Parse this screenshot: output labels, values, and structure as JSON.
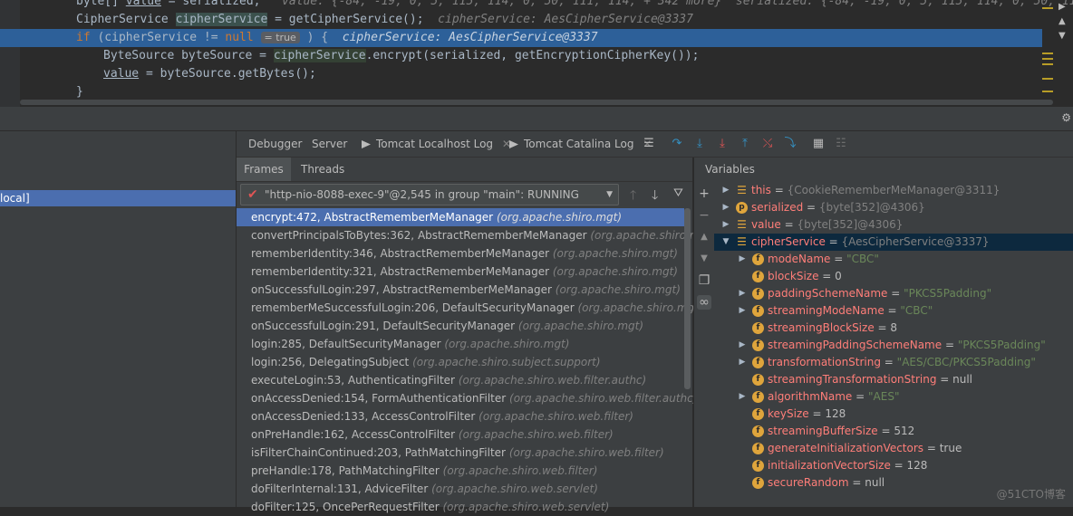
{
  "editor": {
    "lines": [
      {
        "code_a": "byte[] ",
        "code_field": "value",
        "code_b": " = serialized;",
        "hint": "value: {-84, -19, 0, 5, 115, 114, 0, 50, 111, 114, + 342 more}  serialized: {-84, -19, 0, 5, 115, 114, 0, 50, 111, 1"
      },
      {
        "code_a": "CipherService ",
        "code_var": "cipherService",
        "code_b": " = getCipherService();",
        "hint": "cipherService: AesCipherService@3337"
      },
      {
        "code_kw": "if",
        "code_a": " (cipherService != ",
        "code_null": "null",
        "pill": "= true",
        "code_b": " ) {",
        "hint": "cipherService: AesCipherService@3337"
      },
      {
        "code_a": "ByteSource byteSource = ",
        "code_var": "cipherService",
        "code_b": ".encrypt(serialized, getEncryptionCipherKey());"
      },
      {
        "code_field": "value",
        "code_b": " = byteSource.getBytes();"
      },
      {
        "code_b": "}"
      }
    ]
  },
  "left_pane": {
    "selected_label": "local]"
  },
  "debug_tabs": {
    "debugger": "Debugger",
    "server": "Server",
    "tomcat_localhost": "Tomcat Localhost Log",
    "tomcat_catalina": "Tomcat Catalina Log"
  },
  "frames_panel": {
    "tab_frames": "Frames",
    "tab_threads": "Threads",
    "thread": "\"http-nio-8088-exec-9\"@2,545 in group \"main\": RUNNING",
    "frames": [
      {
        "method": "encrypt:472, AbstractRememberMeManager",
        "pkg": "(org.apache.shiro.mgt)"
      },
      {
        "method": "convertPrincipalsToBytes:362, AbstractRememberMeManager",
        "pkg": "(org.apache.shiro.mgt)"
      },
      {
        "method": "rememberIdentity:346, AbstractRememberMeManager",
        "pkg": "(org.apache.shiro.mgt)"
      },
      {
        "method": "rememberIdentity:321, AbstractRememberMeManager",
        "pkg": "(org.apache.shiro.mgt)"
      },
      {
        "method": "onSuccessfulLogin:297, AbstractRememberMeManager",
        "pkg": "(org.apache.shiro.mgt)"
      },
      {
        "method": "rememberMeSuccessfulLogin:206, DefaultSecurityManager",
        "pkg": "(org.apache.shiro.mgt)"
      },
      {
        "method": "onSuccessfulLogin:291, DefaultSecurityManager",
        "pkg": "(org.apache.shiro.mgt)"
      },
      {
        "method": "login:285, DefaultSecurityManager",
        "pkg": "(org.apache.shiro.mgt)"
      },
      {
        "method": "login:256, DelegatingSubject",
        "pkg": "(org.apache.shiro.subject.support)"
      },
      {
        "method": "executeLogin:53, AuthenticatingFilter",
        "pkg": "(org.apache.shiro.web.filter.authc)"
      },
      {
        "method": "onAccessDenied:154, FormAuthenticationFilter",
        "pkg": "(org.apache.shiro.web.filter.authc)"
      },
      {
        "method": "onAccessDenied:133, AccessControlFilter",
        "pkg": "(org.apache.shiro.web.filter)"
      },
      {
        "method": "onPreHandle:162, AccessControlFilter",
        "pkg": "(org.apache.shiro.web.filter)"
      },
      {
        "method": "isFilterChainContinued:203, PathMatchingFilter",
        "pkg": "(org.apache.shiro.web.filter)"
      },
      {
        "method": "preHandle:178, PathMatchingFilter",
        "pkg": "(org.apache.shiro.web.filter)"
      },
      {
        "method": "doFilterInternal:131, AdviceFilter",
        "pkg": "(org.apache.shiro.web.servlet)"
      },
      {
        "method": "doFilter:125, OncePerRequestFilter",
        "pkg": "(org.apache.shiro.web.servlet)"
      }
    ]
  },
  "variables_panel": {
    "title": "Variables",
    "vars": [
      {
        "name": "this",
        "value": "{CookieRememberMeManager@3311}",
        "vtype": "meta",
        "icon": "list",
        "expandable": true,
        "indent": 0
      },
      {
        "name": "serialized",
        "value": "{byte[352]@4306}",
        "vtype": "meta",
        "icon": "p",
        "expandable": true,
        "indent": 0
      },
      {
        "name": "value",
        "value": "{byte[352]@4306}",
        "vtype": "meta",
        "icon": "list",
        "expandable": true,
        "indent": 0
      },
      {
        "name": "cipherService",
        "value": "{AesCipherService@3337}",
        "vtype": "meta",
        "icon": "list",
        "expandable": true,
        "expanded": true,
        "indent": 0,
        "selected": true
      },
      {
        "name": "modeName",
        "value": "\"CBC\"",
        "vtype": "str",
        "icon": "f",
        "expandable": true,
        "indent": 1
      },
      {
        "name": "blockSize",
        "value": "0",
        "vtype": "num",
        "icon": "f",
        "expandable": false,
        "indent": 1
      },
      {
        "name": "paddingSchemeName",
        "value": "\"PKCS5Padding\"",
        "vtype": "str",
        "icon": "f",
        "expandable": true,
        "indent": 1
      },
      {
        "name": "streamingModeName",
        "value": "\"CBC\"",
        "vtype": "str",
        "icon": "f",
        "expandable": true,
        "indent": 1
      },
      {
        "name": "streamingBlockSize",
        "value": "8",
        "vtype": "num",
        "icon": "f",
        "expandable": false,
        "indent": 1
      },
      {
        "name": "streamingPaddingSchemeName",
        "value": "\"PKCS5Padding\"",
        "vtype": "str",
        "icon": "f",
        "expandable": true,
        "indent": 1
      },
      {
        "name": "transformationString",
        "value": "\"AES/CBC/PKCS5Padding\"",
        "vtype": "str",
        "icon": "f",
        "expandable": true,
        "indent": 1
      },
      {
        "name": "streamingTransformationString",
        "value": "null",
        "vtype": "num",
        "icon": "f",
        "expandable": false,
        "indent": 1
      },
      {
        "name": "algorithmName",
        "value": "\"AES\"",
        "vtype": "str",
        "icon": "f",
        "expandable": true,
        "indent": 1
      },
      {
        "name": "keySize",
        "value": "128",
        "vtype": "num",
        "icon": "f",
        "expandable": false,
        "indent": 1
      },
      {
        "name": "streamingBufferSize",
        "value": "512",
        "vtype": "num",
        "icon": "f",
        "expandable": false,
        "indent": 1
      },
      {
        "name": "generateInitializationVectors",
        "value": "true",
        "vtype": "num",
        "icon": "f",
        "expandable": false,
        "indent": 1
      },
      {
        "name": "initializationVectorSize",
        "value": "128",
        "vtype": "num",
        "icon": "f",
        "expandable": false,
        "indent": 1
      },
      {
        "name": "secureRandom",
        "value": "null",
        "vtype": "num",
        "icon": "f",
        "expandable": false,
        "indent": 1
      }
    ]
  },
  "watermark": "@51CTO博客"
}
